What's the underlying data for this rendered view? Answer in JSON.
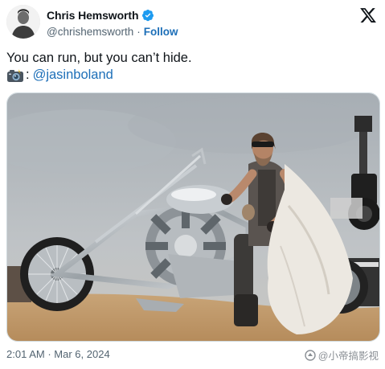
{
  "author": {
    "display_name": "Chris Hemsworth",
    "handle": "@chrishemsworth",
    "separator": "·",
    "follow_label": "Follow",
    "verified_icon": "verified-badge-icon",
    "verified_color": "#1d9bf0"
  },
  "platform_icon": "x-logo-icon",
  "tweet": {
    "line1": "You can run, but you can’t hide.",
    "camera_icon": "camera-flash-icon",
    "colon": ":",
    "mention": "@jasinboland",
    "link_color": "#1d6fb8"
  },
  "media": {
    "alt": "photo"
  },
  "meta": {
    "time": "2:01 AM",
    "separator": "·",
    "date": "Mar 6, 2024"
  },
  "watermark": {
    "text": "@小帝搞影视"
  }
}
